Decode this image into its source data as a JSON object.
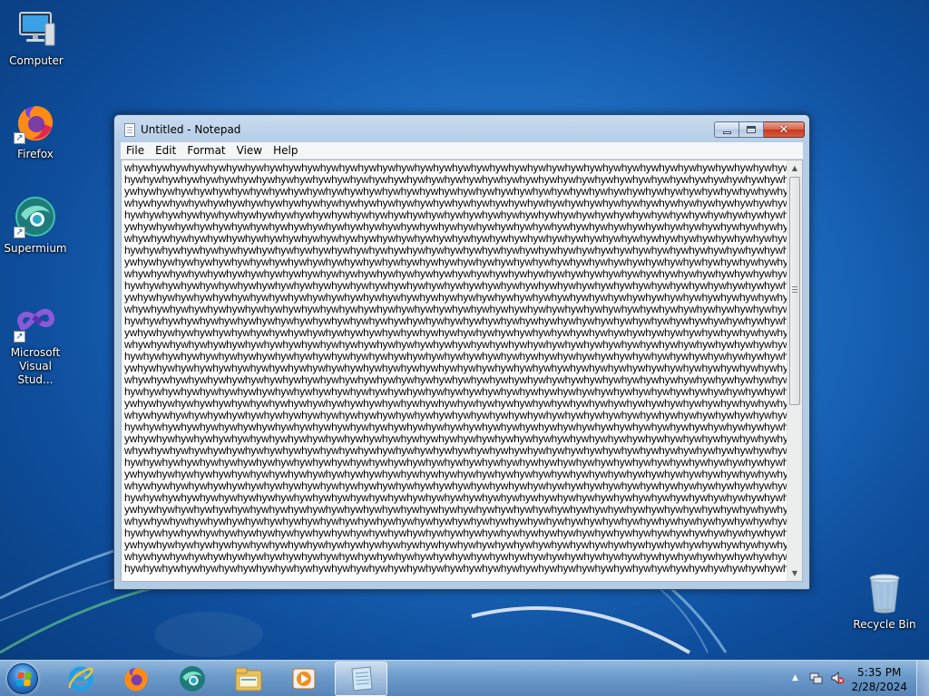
{
  "desktop": {
    "icons": [
      {
        "label": "Computer",
        "icon": "computer-icon"
      },
      {
        "label": "Firefox",
        "icon": "firefox-icon"
      },
      {
        "label": "Supermium",
        "icon": "supermium-icon"
      },
      {
        "label": "Microsoft Visual Stud...",
        "icon": "visual-studio-icon"
      },
      {
        "label": "Recycle Bin",
        "icon": "recycle-bin-icon"
      }
    ]
  },
  "window": {
    "title": "Untitled - Notepad",
    "menu": [
      "File",
      "Edit",
      "Format",
      "View",
      "Help"
    ],
    "text_lines": [
      "whywhywhywhywhywhywhywhywhywhywhywhywhywhywhywhywhywhywhywhywhywhywhywhywhywhywhywhywhywhywhywhywhywhywhywhywhyw",
      "hywhywhywhywhywhywhywhywhywhywhywhywhywhywhywhywhywhywhywhywhywhywhywhywhywhywhywhywhywhywhywhywhywhywhywhywhywh",
      "ywhywhywhywhywhywhywhywhywhywhywhywhywhywhywhywhywhywhywhywhywhywhywhywhywhywhywhywhywhywhywhywhywhywhywhywhywhy",
      "whywhywhywhywhywhywhywhywhywhywhywhywhywhywhywhywhywhywhywhywhywhywhywhywhywhywhywhywhywhywhywhywhywhywhywhywhyw",
      "hywhywhywhywhywhywhywhywhywhywhywhywhywhywhywhywhywhywhywhywhywhywhywhywhywhywhywhywhywhywhywhywhywhywhywhywhywh",
      "ywhywhywhywhywhywhywhywhywhywhywhywhywhywhywhywhywhywhywhywhywhywhywhywhywhywhywhywhywhywhywhywhywhywhywhywhywhy",
      "whywhywhywhywhywhywhywhywhywhywhywhywhywhywhywhywhywhywhywhywhywhywhywhywhywhywhywhywhywhywhywhywhywhywhywhywhyw",
      "hywhywhywhywhywhywhywhywhywhywhywhywhywhywhywhywhywhywhywhywhywhywhywhywhywhywhywhywhywhywhywhywhywhywhywhywhywh",
      "ywhywhywhywhywhywhywhywhywhywhywhywhywhywhywhywhywhywhywhywhywhywhywhywhywhywhywhywhywhywhywhywhywhywhywhywhywhy",
      "whywhywhywhywhywhywhywhywhywhywhywhywhywhywhywhywhywhywhywhywhywhywhywhywhywhywhywhywhywhywhywhywhywhywhywhywhyw",
      "hywhywhywhywhywhywhywhywhywhywhywhywhywhywhywhywhywhywhywhywhywhywhywhywhywhywhywhywhywhywhywhywhywhywhywhywhywh",
      "ywhywhywhywhywhywhywhywhywhywhywhywhywhywhywhywhywhywhywhywhywhywhywhywhywhywhywhywhywhywhywhywhywhywhywhywhywhy",
      "whywhywhywhywhywhywhywhywhywhywhywhywhywhywhywhywhywhywhywhywhywhywhywhywhywhywhywhywhywhywhywhywhywhywhywhywhyw",
      "hywhywhywhywhywhywhywhywhywhywhywhywhywhywhywhywhywhywhywhywhywhywhywhywhywhywhywhywhywhywhywhywhywhywhywhywhywh",
      "ywhywhywhywhywhywhywhywhywhywhywhywhywhywhywhywhywhywhywhywhywhywhywhywhywhywhywhywhywhywhywhywhywhywhywhywhywhy",
      "whywhywhywhywhywhywhywhywhywhywhywhywhywhywhywhywhywhywhywhywhywhywhywhywhywhywhywhywhywhywhywhywhywhywhywhywhyw",
      "hywhywhywhywhywhywhywhywhywhywhywhywhywhywhywhywhywhywhywhywhywhywhywhywhywhywhywhywhywhywhywhywhywhywhywhywhywh",
      "ywhywhywhywhywhywhywhywhywhywhywhywhywhywhywhywhywhywhywhywhywhywhywhywhywhywhywhywhywhywhywhywhywhywhywhywhywhy",
      "whywhywhywhywhywhywhywhywhywhywhywhywhywhywhywhywhywhywhywhywhywhywhywhywhywhywhywhywhywhywhywhywhywhywhywhywhyw",
      "hywhywhywhywhywhywhywhywhywhywhywhywhywhywhywhywhywhywhywhywhywhywhywhywhywhywhywhywhywhywhywhywhywhywhywhywhywh",
      "ywhywhywhywhywhywhywhywhywhywhywhywhywhywhywhywhywhywhywhywhywhywhywhywhywhywhywhywhywhywhywhywhywhywhywhywhywhy",
      "whywhywhywhywhywhywhywhywhywhywhywhywhywhywhywhywhywhywhywhywhywhywhywhywhywhywhywhywhywhywhywhywhywhywhywhywhyw",
      "hywhywhywhywhywhywhywhywhywhywhywhywhywhywhywhywhywhywhywhywhywhywhywhywhywhywhywhywhywhywhywhywhywhywhywhywhywh",
      "ywhywhywhywhywhywhywhywhywhywhywhywhywhywhywhywhywhywhywhywhywhywhywhywhywhywhywhywhywhywhywhywhywhywhywhywhywhy",
      "whywhywhywhywhywhywhywhywhywhywhywhywhywhywhywhywhywhywhywhywhywhywhywhywhywhywhywhywhywhywhywhywhywhywhywhywhyw",
      "hywhywhywhywhywhywhywhywhywhywhywhywhywhywhywhywhywhywhywhywhywhywhywhywhywhywhywhywhywhywhywhywhywhywhywhywhywh",
      "ywhywhywhywhywhywhywhywhywhywhywhywhywhywhywhywhywhywhywhywhywhywhywhywhywhywhywhywhywhywhywhywhywhywhywhywhywhy",
      "whywhywhywhywhywhywhywhywhywhywhywhywhywhywhywhywhywhywhywhywhywhywhywhywhywhywhywhywhywhywhywhywhywhywhywhywhyw",
      "hywhywhywhywhywhywhywhywhywhywhywhywhywhywhywhywhywhywhywhywhywhywhywhywhywhywhywhywhywhywhywhywhywhywhywhywhywh",
      "ywhywhywhywhywhywhywhywhywhywhywhywhywhywhywhywhywhywhywhywhywhywhywhywhywhywhywhywhywhywhywhywhywhywhywhywhywhy",
      "whywhywhywhywhywhywhywhywhywhywhywhywhywhywhywhywhywhywhywhywhywhywhywhywhywhywhywhywhywhywhywhywhywhywhywhywhyw",
      "hywhywhywhywhywhywhywhywhywhywhywhywhywhywhywhywhywhywhywhywhywhywhywhywhywhywhywhywhywhywhywhywhywhywhywhywhywh",
      "ywhywhywhywhywhywhywhywhywhywhywhywhywhywhywhywhywhywhywhywhywhywhywhywhywhywhywhywhywhywhywhywhywhywhywhywhywhy",
      "whywhywhywhywhywhywhywhywhywhywhywhywhywhywhywhywhywhywhywhywhywhywhywhywhywhywhywhywhywhywhywhywhywhywhywhywhyw",
      "hywhywhywhywhywhywhywhywhywhywhywhywhywhywhywhywhywhywhywhywhywhywhywhywhywhywhywhywhywhywhywhywhywhywhywhywhywh"
    ]
  },
  "taskbar": {
    "pinned": [
      {
        "icon": "internet-explorer-icon"
      },
      {
        "icon": "firefox-icon"
      },
      {
        "icon": "supermium-icon"
      },
      {
        "icon": "file-explorer-icon"
      },
      {
        "icon": "media-player-icon"
      },
      {
        "icon": "notepad-icon",
        "active": true
      }
    ],
    "clock": {
      "time": "5:35 PM",
      "date": "2/28/2024"
    }
  },
  "colors": {
    "desktop": "#1f6fc4",
    "close_button": "#c7371c"
  }
}
